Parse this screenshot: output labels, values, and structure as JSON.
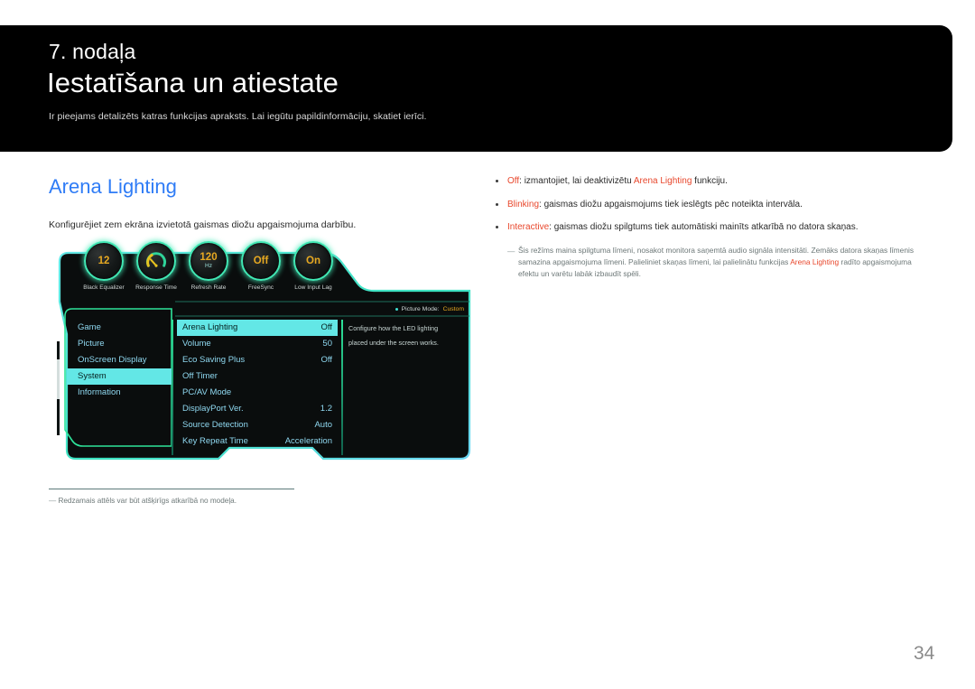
{
  "header": {
    "chapter": "7. nodaļa",
    "title": "Iestatīšana un atiestate",
    "subtitle": "Ir pieejams detalizēts katras funkcijas apraksts. Lai iegūtu papildinformāciju, skatiet ierīci."
  },
  "section": {
    "title": "Arena Lighting",
    "description": "Konfigurējiet zem ekrāna izvietotā gaismas diožu apgaismojuma darbību."
  },
  "osd": {
    "dials": [
      {
        "icon": "number-badge-icon",
        "value": "12",
        "unit": "",
        "label": "Black Equalizer"
      },
      {
        "icon": "gauge-icon",
        "value": "",
        "unit": "",
        "label": "Response Time"
      },
      {
        "icon": "refresh-rate-icon",
        "value": "120",
        "unit": "Hz",
        "label": "Refresh Rate"
      },
      {
        "icon": "freesync-icon",
        "value": "Off",
        "unit": "",
        "label": "FreeSync"
      },
      {
        "icon": "low-input-lag-icon",
        "value": "On",
        "unit": "",
        "label": "Low Input Lag"
      }
    ],
    "status_bar": {
      "label": "Picture Mode:",
      "value": "Custom"
    },
    "menu_items": [
      {
        "label": "Game",
        "selected": false
      },
      {
        "label": "Picture",
        "selected": false
      },
      {
        "label": "OnScreen Display",
        "selected": false
      },
      {
        "label": "System",
        "selected": true
      },
      {
        "label": "Information",
        "selected": false
      }
    ],
    "submenu_items": [
      {
        "label": "Arena Lighting",
        "value": "Off",
        "selected": true
      },
      {
        "label": "Volume",
        "value": "50",
        "selected": false
      },
      {
        "label": "Eco Saving Plus",
        "value": "Off",
        "selected": false
      },
      {
        "label": "Off Timer",
        "value": "",
        "selected": false
      },
      {
        "label": "PC/AV Mode",
        "value": "",
        "selected": false
      },
      {
        "label": "DisplayPort Ver.",
        "value": "1.2",
        "selected": false
      },
      {
        "label": "Source Detection",
        "value": "Auto",
        "selected": false
      },
      {
        "label": "Key Repeat Time",
        "value": "Acceleration",
        "selected": false
      }
    ],
    "help_lines": [
      "Configure how the LED lighting",
      "placed under the screen works."
    ]
  },
  "footnote": {
    "dash": "―",
    "text": "Redzamais attēls var būt atšķirīgs atkarībā no modeļa."
  },
  "bullets": [
    {
      "keyword": "Off",
      "text_before": ": izmantojiet, lai deaktivizētu ",
      "keyword2": "Arena Lighting",
      "text_after": " funkciju."
    },
    {
      "keyword": "Blinking",
      "text_before": ": gaismas diožu apgaismojums tiek ieslēgts pēc noteikta intervāla.",
      "keyword2": "",
      "text_after": ""
    },
    {
      "keyword": "Interactive",
      "text_before": ": gaismas diožu spilgtums tiek automātiski mainīts atkarībā no datora skaņas.",
      "keyword2": "",
      "text_after": ""
    }
  ],
  "note": {
    "dash": "―",
    "part1": "Šis režīms maina spilgtuma līmeni, nosakot monitora saņemtā audio signāla intensitāti. Zemāks datora skaņas līmenis samazina apgaismojuma līmeni. Palieliniet skaņas līmeni, lai palielinātu funkcijas ",
    "keyword": "Arena Lighting",
    "part2": " radīto apgaismojuma efektu un varētu labāk izbaudīt spēli."
  },
  "page_number": "34",
  "colors": {
    "accent_blue": "#2f7cf6",
    "osd_cyan": "#63e7e6",
    "osd_green": "#41e8b4",
    "osd_amber": "#e7a921",
    "keyword_red": "#e8472c"
  }
}
